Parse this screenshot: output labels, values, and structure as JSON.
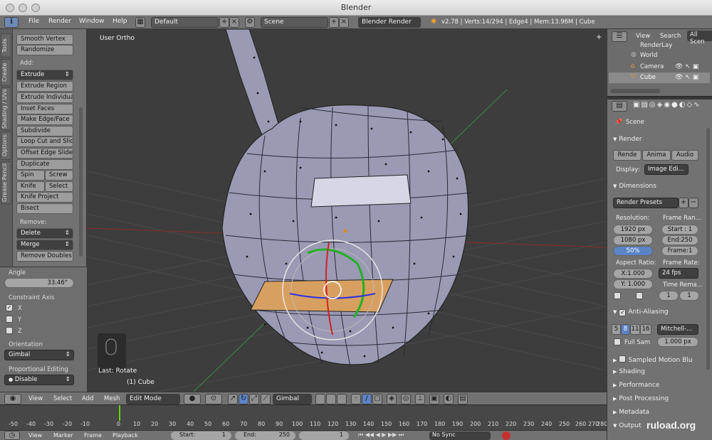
{
  "window": {
    "title": "Blender"
  },
  "info_header": {
    "menus": [
      "File",
      "Render",
      "Window",
      "Help"
    ],
    "screen_layout": "Default",
    "scene": "Scene",
    "render_engine": "Blender Render",
    "stats": "v2.78 | Verts:14/294 | Edge4 | Mem:13.96M | Cube"
  },
  "tool_tabs": [
    "Tools",
    "Create",
    "Shading / UVs",
    "Options",
    "Grease Pencil"
  ],
  "tool_shelf": {
    "top_buttons": [
      "Smooth Vertex",
      "Randomize"
    ],
    "add_label": "Add:",
    "extrude": "Extrude",
    "add_buttons": [
      "Extrude Region",
      "Extrude Individual",
      "Inset Faces",
      "Make Edge/Face",
      "Subdivide",
      "Loop Cut and Slide",
      "Offset Edge Slide",
      "Duplicate"
    ],
    "spin": "Spin",
    "screw": "Screw",
    "knife": "Knife",
    "select": "Select",
    "knife_project": "Knife Project",
    "bisect": "Bisect",
    "remove_label": "Remove:",
    "delete": "Delete",
    "merge": "Merge",
    "remove_doubles": "Remove Doubles"
  },
  "last_op": {
    "angle_label": "Angle",
    "angle_value": "33.46°",
    "constraint_label": "Constraint Axis",
    "axis_x": "X",
    "axis_y": "Y",
    "axis_z": "Z",
    "orientation_label": "Orientation",
    "orientation_value": "Gimbal",
    "proportional_label": "Proportional Editing",
    "proportional_value": "Disable"
  },
  "viewport": {
    "view_name": "User Ortho",
    "last_op": "Last: Rotate",
    "object_label": "(1) Cube"
  },
  "viewport_header": {
    "menus": [
      "View",
      "Select",
      "Add",
      "Mesh"
    ],
    "mode": "Edit Mode",
    "orientation": "Gimbal"
  },
  "timeline": {
    "ticks": [
      "-50",
      "-40",
      "-30",
      "-20",
      "-10",
      "0",
      "10",
      "20",
      "30",
      "40",
      "50",
      "60",
      "70",
      "80",
      "90",
      "100",
      "110",
      "120",
      "130",
      "140",
      "150",
      "160",
      "170",
      "180",
      "190",
      "200",
      "210",
      "220",
      "230",
      "240",
      "250",
      "260",
      "270",
      "280"
    ],
    "menus": [
      "View",
      "Marker",
      "Frame",
      "Playback"
    ],
    "start": "Start:",
    "start_value": "1",
    "end": "End:",
    "end_value": "250",
    "current": "1",
    "sync": "No Sync"
  },
  "outliner": {
    "menus": [
      "View",
      "Search"
    ],
    "filter": "All Scen",
    "rows": [
      "RenderLay",
      "World",
      "Camera",
      "Cube"
    ]
  },
  "properties": {
    "context": "Scene",
    "render_section": "Render",
    "render_btn": "Rende",
    "anim_btn": "Anima",
    "audio_btn": "Audio",
    "display_label": "Display:",
    "display_value": "Image Edi...",
    "dimensions_section": "Dimensions",
    "render_presets": "Render Presets",
    "resolution_label": "Resolution:",
    "res_x": "1920 px",
    "res_y": "1080 px",
    "res_pct": "50%",
    "frame_range_label": "Frame Ran...",
    "frame_start": "Start : 1",
    "frame_end": "End:250",
    "frame_step": "Frame:1",
    "aspect_label": "Aspect Ratio:",
    "aspect_x": "X:1.000",
    "aspect_y": "Y: 1.000",
    "frame_rate_label": "Frame Rate:",
    "frame_rate": "24 fps",
    "time_remap": "Time Rema...",
    "remap_old": "1",
    "remap_new": "1",
    "aa_section": "Anti-Aliasing",
    "aa_samples": [
      "5",
      "8",
      "11",
      "16"
    ],
    "aa_filter": "Mitchell-...",
    "full_sample": "Full Sam",
    "filter_size": "1.000 px",
    "motion_blur": "Sampled Motion Blu",
    "collapsed": [
      "Shading",
      "Performance",
      "Post Processing",
      "Metadata",
      "Output"
    ]
  },
  "watermark": "ruload.org",
  "colors": {
    "mesh_face": "#9a9ab4",
    "selected_face": "#d8a060",
    "x_axis": "#c02020",
    "y_axis": "#20b020",
    "z_axis": "#3030e0"
  }
}
